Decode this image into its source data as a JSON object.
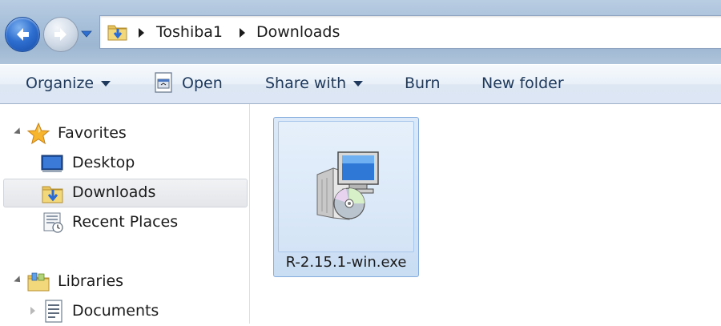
{
  "address_bar": {
    "crumbs": [
      "Toshiba1",
      "Downloads"
    ]
  },
  "command_bar": {
    "organize": "Organize",
    "open": "Open",
    "share_with": "Share with",
    "burn": "Burn",
    "new_folder": "New folder"
  },
  "nav_pane": {
    "favorites": {
      "label": "Favorites",
      "items": [
        {
          "label": "Desktop",
          "icon": "desktop-icon"
        },
        {
          "label": "Downloads",
          "icon": "downloads-folder-icon",
          "selected": true
        },
        {
          "label": "Recent Places",
          "icon": "recent-places-icon"
        }
      ]
    },
    "libraries": {
      "label": "Libraries",
      "items": [
        {
          "label": "Documents",
          "icon": "documents-icon"
        }
      ]
    }
  },
  "content": {
    "files": [
      {
        "name": "R-2.15.1-win.exe",
        "icon": "installer-icon",
        "selected": true
      }
    ]
  },
  "colors": {
    "accent_blue": "#2f6fd0",
    "selection_border": "#84acdd",
    "command_text": "#1e395b"
  }
}
